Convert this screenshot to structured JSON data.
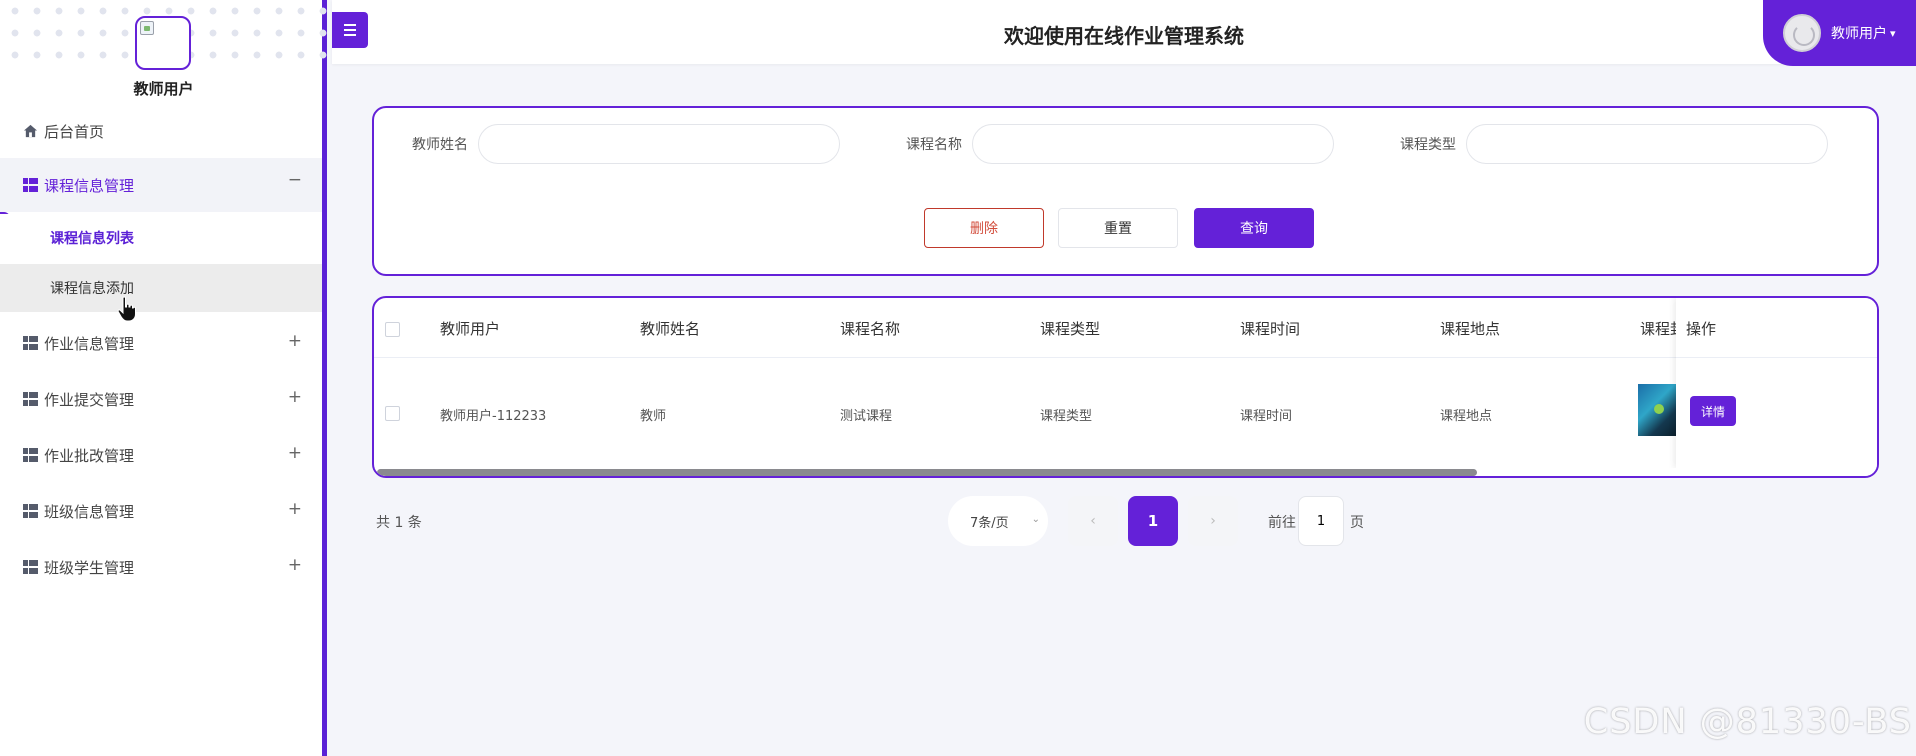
{
  "app": {
    "title": "欢迎使用在线作业管理系统",
    "current_user": "教师用户"
  },
  "sidebar": {
    "username": "教师用户",
    "home": "后台首页",
    "menus": [
      {
        "label": "课程信息管理",
        "sign": "−",
        "submenu": [
          {
            "label": "课程信息列表"
          },
          {
            "label": "课程信息添加"
          }
        ]
      },
      {
        "label": "作业信息管理",
        "sign": "+"
      },
      {
        "label": "作业提交管理",
        "sign": "+"
      },
      {
        "label": "作业批改管理",
        "sign": "+"
      },
      {
        "label": "班级信息管理",
        "sign": "+"
      },
      {
        "label": "班级学生管理",
        "sign": "+"
      }
    ]
  },
  "search": {
    "fields": [
      {
        "label": "教师姓名",
        "value": ""
      },
      {
        "label": "课程名称",
        "value": ""
      },
      {
        "label": "课程类型",
        "value": ""
      }
    ],
    "delete_label": "删除",
    "reset_label": "重置",
    "query_label": "查询"
  },
  "table": {
    "headers": [
      "教师用户",
      "教师姓名",
      "课程名称",
      "课程类型",
      "课程时间",
      "课程地点",
      "课程封"
    ],
    "action_header": "操作",
    "rows": [
      {
        "cells": [
          "教师用户-112233",
          "教师",
          "测试课程",
          "课程类型",
          "课程时间",
          "课程地点"
        ],
        "action": "详情"
      }
    ]
  },
  "pagination": {
    "total": "共 1 条",
    "page_size": "7条/页",
    "current": "1",
    "goto_prefix": "前往",
    "goto_value": "1",
    "goto_suffix": "页"
  },
  "watermark": "CSDN @81330-BS",
  "colors": {
    "accent": "#6421d8",
    "danger": "#d24c3b"
  }
}
